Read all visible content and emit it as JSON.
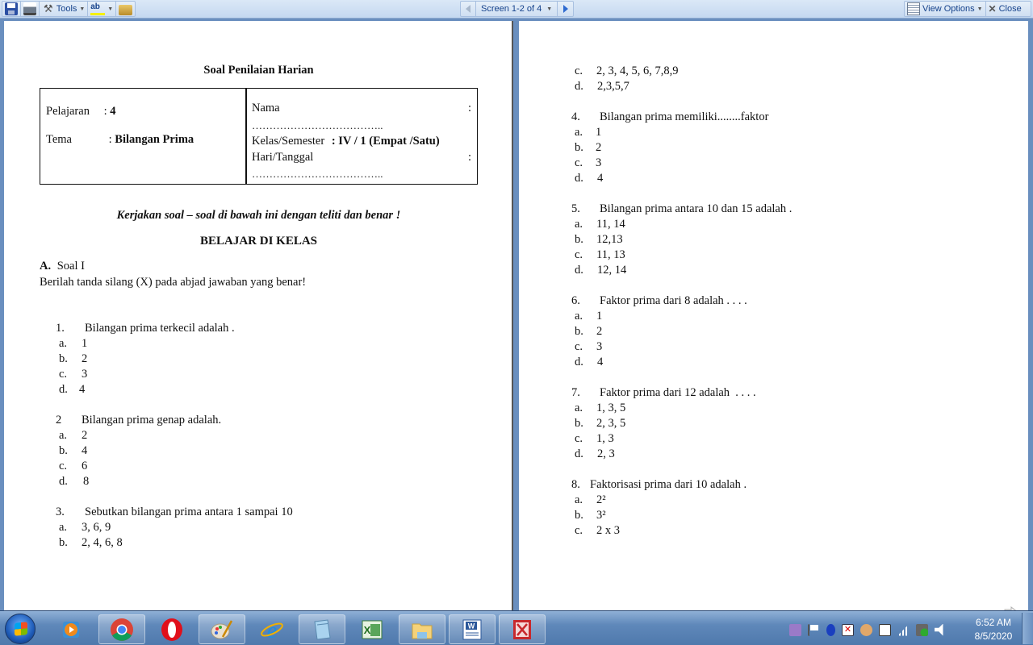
{
  "toolbar": {
    "tools_label": "Tools",
    "screen_indicator": "Screen 1-2 of 4",
    "view_options_label": "View Options",
    "close_label": "Close"
  },
  "document": {
    "title": "Soal Penilaian Harian",
    "header_table": {
      "pelajaran_label": "Pelajaran",
      "pelajaran_sep": ":",
      "pelajaran_value": "4",
      "tema_label": "Tema",
      "tema_sep": ":",
      "tema_value": "Bilangan Prima",
      "nama_label": "Nama",
      "nama_colon": ":",
      "dots": "………………………………..",
      "kelas_label": "Kelas/Semester",
      "kelas_value": ": IV / 1 (Empat /Satu)",
      "hari_label": "Hari/Tanggal",
      "hari_colon": ":"
    },
    "instruction": "Kerjakan soal – soal di bawah ini dengan teliti dan benar !",
    "section_heading": "BELAJAR DI KELAS",
    "subsection_letter": "A.",
    "subsection_title": "Soal I",
    "directions": "Berilah tanda silang (X) pada abjad jawaban yang benar!",
    "questions": [
      {
        "num": "1.",
        "text": "Bilangan prima terkecil adalah .",
        "options": [
          {
            "letter": "a.",
            "text": "1"
          },
          {
            "letter": "b.",
            "text": "2"
          },
          {
            "letter": "c.",
            "text": "3"
          },
          {
            "letter": "d.",
            "text": "4"
          }
        ]
      },
      {
        "num": "2",
        "text": "Bilangan prima genap adalah.",
        "options": [
          {
            "letter": "a.",
            "text": "2"
          },
          {
            "letter": "b.",
            "text": "4"
          },
          {
            "letter": "c.",
            "text": "6"
          },
          {
            "letter": "d.",
            "text": "8"
          }
        ]
      },
      {
        "num": "3.",
        "text": "Sebutkan bilangan prima antara 1 sampai 10",
        "options": [
          {
            "letter": "a.",
            "text": "3, 6, 9"
          },
          {
            "letter": "b.",
            "text": "2, 4, 6, 8"
          },
          {
            "letter": "c.",
            "text": "2, 3, 4, 5, 6, 7,8,9"
          },
          {
            "letter": "d.",
            "text": "2,3,5,7"
          }
        ]
      },
      {
        "num": "4.",
        "text": "Bilangan prima memiliki........faktor",
        "options": [
          {
            "letter": "a.",
            "text": "1"
          },
          {
            "letter": "b.",
            "text": "2"
          },
          {
            "letter": "c.",
            "text": "3"
          },
          {
            "letter": "d.",
            "text": "4"
          }
        ]
      },
      {
        "num": "5.",
        "text": "Bilangan prima antara 10 dan 15 adalah .",
        "options": [
          {
            "letter": "a.",
            "text": "11, 14"
          },
          {
            "letter": "b.",
            "text": "12,13"
          },
          {
            "letter": "c.",
            "text": "11, 13"
          },
          {
            "letter": "d.",
            "text": "12, 14"
          }
        ]
      },
      {
        "num": "6.",
        "text": "Faktor prima dari 8 adalah . . . .",
        "options": [
          {
            "letter": "a.",
            "text": "1"
          },
          {
            "letter": "b.",
            "text": "2"
          },
          {
            "letter": "c.",
            "text": "3"
          },
          {
            "letter": "d.",
            "text": "4"
          }
        ]
      },
      {
        "num": "7.",
        "text": "Faktor prima dari 12 adalah  . . . .",
        "options": [
          {
            "letter": "a.",
            "text": "1, 3, 5"
          },
          {
            "letter": "b.",
            "text": "2, 3, 5"
          },
          {
            "letter": "c.",
            "text": "1, 3"
          },
          {
            "letter": "d.",
            "text": "2, 3"
          }
        ]
      },
      {
        "num": "8.",
        "text": "Faktorisasi prima dari 10 adalah .",
        "options": [
          {
            "letter": "a.",
            "text": "2²"
          },
          {
            "letter": "b.",
            "text": "3²"
          },
          {
            "letter": "c.",
            "text": "2 x 3"
          }
        ]
      }
    ]
  },
  "taskbar": {
    "apps": [
      "windows-media-player",
      "chrome",
      "opera",
      "paint",
      "internet-explorer",
      "notepad",
      "excel",
      "windows-explorer",
      "word",
      "pdf-viewer"
    ],
    "tray_icons": [
      "onenote",
      "action-center-flag",
      "bluetooth",
      "network-error",
      "user-accounts",
      "power",
      "signal",
      "usb-safe-remove",
      "volume"
    ],
    "time": "6:52 AM",
    "date": "8/5/2020"
  },
  "colors": {
    "toolbar_text": "#15428b",
    "background": "#6a8fbf"
  }
}
